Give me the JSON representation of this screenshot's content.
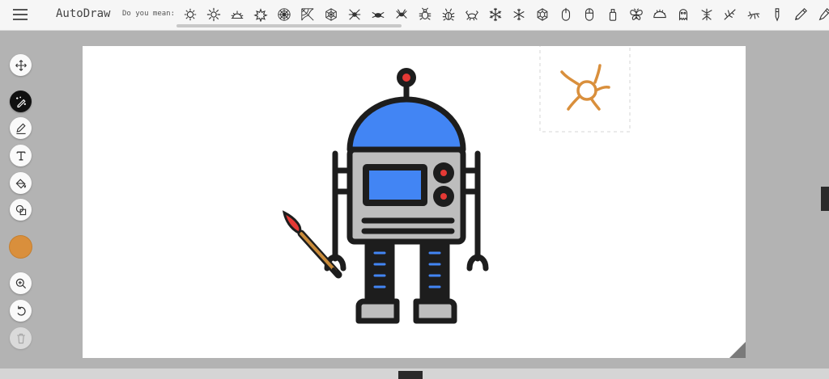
{
  "app": {
    "name": "AutoDraw"
  },
  "suggestions": {
    "label": "Do you mean:",
    "items": [
      "sun-icon",
      "sun-icon",
      "sunrise-icon",
      "sun-icon",
      "spiderweb-icon",
      "spiderweb-icon",
      "spiderweb-icon",
      "spider-icon",
      "spider-icon",
      "spider-icon",
      "bug-icon",
      "bug-icon",
      "crab-icon",
      "snowflake-icon",
      "snowflake-icon",
      "snowflake-icon",
      "mouse-icon",
      "mouse-icon",
      "bottle-icon",
      "butterfly-icon",
      "hedgehog-icon",
      "monster-icon",
      "mosquito-icon",
      "mosquito-icon",
      "mosquito-icon",
      "pen-icon",
      "pen-icon",
      "pen-icon"
    ]
  },
  "tools": [
    {
      "name": "move-tool",
      "icon": "move-icon"
    },
    {
      "name": "autodraw-tool",
      "icon": "autodraw-icon",
      "active": true
    },
    {
      "name": "draw-tool",
      "icon": "pencil-icon"
    },
    {
      "name": "type-tool",
      "icon": "text-icon"
    },
    {
      "name": "fill-tool",
      "icon": "paint-bucket-icon"
    },
    {
      "name": "shape-tool",
      "icon": "shapes-icon"
    },
    {
      "name": "color-picker",
      "color": "#d98f3c"
    },
    {
      "name": "zoom-tool",
      "icon": "zoom-icon"
    },
    {
      "name": "undo-tool",
      "icon": "undo-icon"
    },
    {
      "name": "delete-tool",
      "icon": "trash-icon",
      "disabled": true
    }
  ],
  "colors": {
    "accent": "#d98f3c",
    "robot_blue": "#4285f4",
    "robot_red": "#e53935",
    "robot_gray": "#bdbdbd",
    "outline": "#1d1d1d"
  }
}
